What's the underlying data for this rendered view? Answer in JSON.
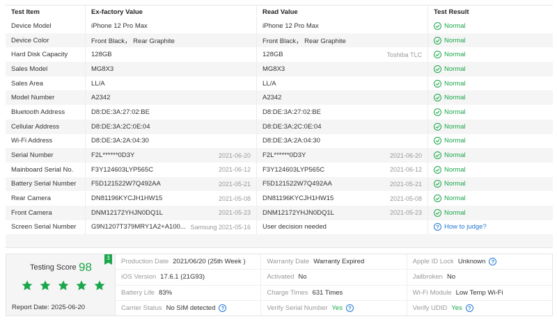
{
  "table": {
    "headers": [
      "Test Item",
      "Ex-factory Value",
      "Read Value",
      "Test Result"
    ],
    "rows": [
      {
        "item": "Device Model",
        "ex": "iPhone 12 Pro Max",
        "ex_sub": "",
        "read": "iPhone 12 Pro Max",
        "read_sub": "",
        "result": "Normal",
        "status": "normal"
      },
      {
        "item": "Device Color",
        "ex": "Front Black， Rear Graphite",
        "ex_sub": "",
        "read": "Front Black， Rear Graphite",
        "read_sub": "",
        "result": "Normal",
        "status": "normal"
      },
      {
        "item": "Hard Disk Capacity",
        "ex": "128GB",
        "ex_sub": "",
        "read": "128GB",
        "read_sub": "Toshiba TLC",
        "result": "Normal",
        "status": "normal"
      },
      {
        "item": "Sales Model",
        "ex": "MG8X3",
        "ex_sub": "",
        "read": "MG8X3",
        "read_sub": "",
        "result": "Normal",
        "status": "normal"
      },
      {
        "item": "Sales Area",
        "ex": "LL/A",
        "ex_sub": "",
        "read": "LL/A",
        "read_sub": "",
        "result": "Normal",
        "status": "normal"
      },
      {
        "item": "Model Number",
        "ex": "A2342",
        "ex_sub": "",
        "read": "A2342",
        "read_sub": "",
        "result": "Normal",
        "status": "normal"
      },
      {
        "item": "Bluetooth Address",
        "ex": "D8:DE:3A:27:02:BE",
        "ex_sub": "",
        "read": "D8:DE:3A:27:02:BE",
        "read_sub": "",
        "result": "Normal",
        "status": "normal"
      },
      {
        "item": "Cellular Address",
        "ex": "D8:DE:3A:2C:0E:04",
        "ex_sub": "",
        "read": "D8:DE:3A:2C:0E:04",
        "read_sub": "",
        "result": "Normal",
        "status": "normal"
      },
      {
        "item": "Wi-Fi Address",
        "ex": "D8:DE:3A:2A:04:30",
        "ex_sub": "",
        "read": "D8:DE:3A:2A:04:30",
        "read_sub": "",
        "result": "Normal",
        "status": "normal"
      },
      {
        "item": "Serial Number",
        "ex": "F2L******0D3Y",
        "ex_sub": "2021-06-20",
        "read": "F2L******0D3Y",
        "read_sub": "2021-06-20",
        "result": "Normal",
        "status": "normal"
      },
      {
        "item": "Mainboard Serial No.",
        "ex": "F3Y124603LYP565C",
        "ex_sub": "2021-06-12",
        "read": "F3Y124603LYP565C",
        "read_sub": "2021-06-12",
        "result": "Normal",
        "status": "normal"
      },
      {
        "item": "Battery Serial Number",
        "ex": "F5D121522W7Q492AA",
        "ex_sub": "2021-05-21",
        "read": "F5D121522W7Q492AA",
        "read_sub": "2021-05-21",
        "result": "Normal",
        "status": "normal"
      },
      {
        "item": "Rear Camera",
        "ex": "DN81196KYCJH1HW15",
        "ex_sub": "2021-05-08",
        "read": "DN81196KYCJH1HW15",
        "read_sub": "2021-05-08",
        "result": "Normal",
        "status": "normal"
      },
      {
        "item": "Front Camera",
        "ex": "DNM12172YHJN0DQ1L",
        "ex_sub": "2021-05-23",
        "read": "DNM12172YHJN0DQ1L",
        "read_sub": "2021-05-23",
        "result": "Normal",
        "status": "normal"
      },
      {
        "item": "Screen Serial Number",
        "ex": "G9N1207T379MRY1A2+A100...",
        "ex_sub": "Samsung 2021-05-16",
        "read": "User decision needed",
        "read_sub": "",
        "result": "How to judge?",
        "status": "judge"
      }
    ]
  },
  "summary": {
    "score_label": "Testing Score",
    "score": "98",
    "rank": "3",
    "stars": 5,
    "report_date": "Report Date:  2025-06-20",
    "columns": [
      [
        {
          "k": "Production Date",
          "v": "2021/06/20 (25th Week )",
          "green": false,
          "help": false
        },
        {
          "k": "iOS Version",
          "v": "17.6.1 (21G93)",
          "green": false,
          "help": false
        },
        {
          "k": "Battery Life",
          "v": "83%",
          "green": false,
          "help": false
        },
        {
          "k": "Carrier Status",
          "v": "No SIM detected",
          "green": false,
          "help": true
        }
      ],
      [
        {
          "k": "Warranty Date",
          "v": "Warranty Expired",
          "green": false,
          "help": false
        },
        {
          "k": "Activated",
          "v": "No",
          "green": false,
          "help": false
        },
        {
          "k": "Charge Times",
          "v": "631 Times",
          "green": false,
          "help": false
        },
        {
          "k": "Verify Serial Number",
          "v": "Yes",
          "green": true,
          "help": true
        }
      ],
      [
        {
          "k": "Apple ID Lock",
          "v": "Unknown",
          "green": false,
          "help": true
        },
        {
          "k": "Jailbroken",
          "v": "No",
          "green": false,
          "help": false
        },
        {
          "k": "Wi-Fi Module",
          "v": "Low Temp Wi-Fi",
          "green": false,
          "help": false
        },
        {
          "k": "Verify UDID",
          "v": "Yes",
          "green": true,
          "help": true
        }
      ]
    ]
  },
  "colors": {
    "green": "#1aa64a",
    "blue": "#1f76d3",
    "alt_row": "#f5f5f5"
  },
  "icons": {
    "normal": "check-circle-icon",
    "judge": "question-circle-icon",
    "star": "star-icon"
  }
}
